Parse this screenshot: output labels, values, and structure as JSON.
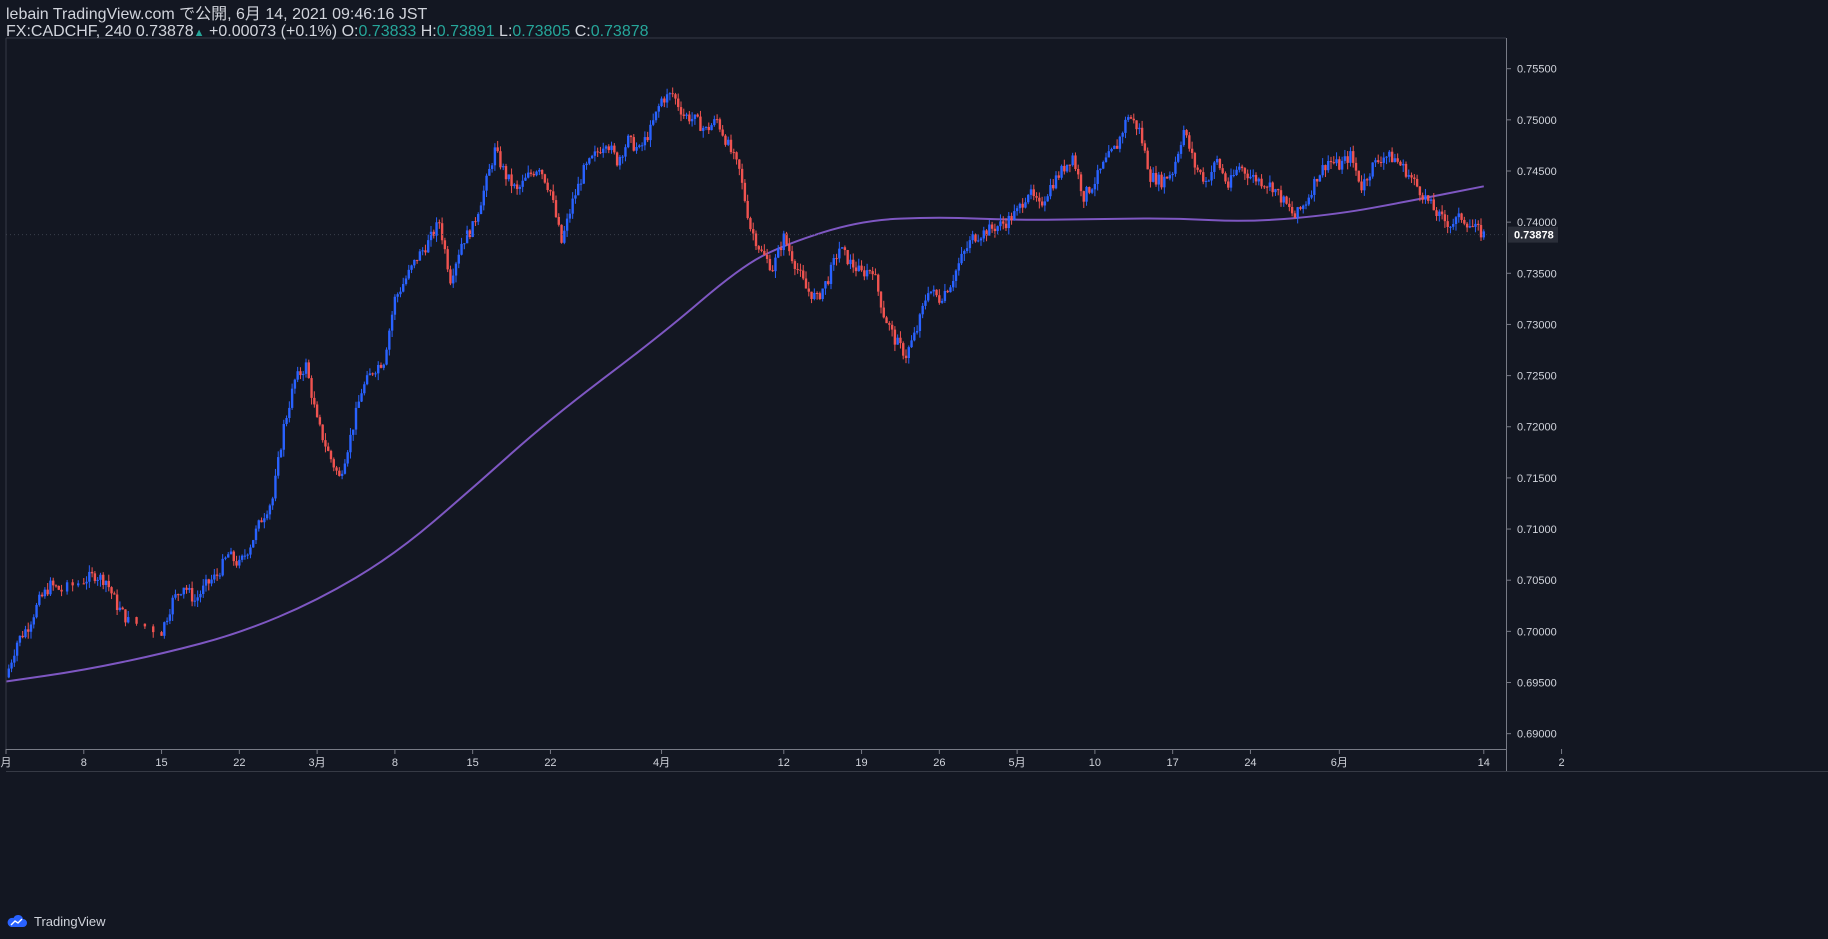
{
  "header": {
    "line1": "lebain TradingView.com で公開, 6月 14, 2021 09:46:16 JST",
    "symbol": "FX:CADCHF, 240",
    "last": "0.73878",
    "change": "+0.00073 (+0.1%)",
    "o_label": "O:",
    "o_value": "0.73833",
    "h_label": "H:",
    "h_value": "0.73891",
    "l_label": "L:",
    "l_value": "0.73805",
    "c_label": "C:",
    "c_value": "0.73878"
  },
  "branding": {
    "label": "TradingView",
    "icon": "tradingview-cloud-icon"
  },
  "colors": {
    "background": "#131722",
    "up": "#2962ff",
    "down": "#ef5350",
    "ma": "#7e57c2",
    "accent": "#26a69a",
    "text": "#d1d4dc",
    "axis": "#363a45"
  },
  "chart_data": {
    "type": "candlestick",
    "symbol": "FX:CADCHF",
    "interval": "240",
    "y_axis": {
      "position": "right",
      "range": [
        0.6885,
        0.758
      ],
      "ticks": [
        "0.69000",
        "0.69500",
        "0.70000",
        "0.70500",
        "0.71000",
        "0.71500",
        "0.72000",
        "0.72500",
        "0.73000",
        "0.73500",
        "0.74000",
        "0.74500",
        "0.75000",
        "0.75500"
      ]
    },
    "x_axis": {
      "range": [
        "2021-02-01",
        "2021-06-16"
      ],
      "ticks": [
        {
          "date": "2021-02-01",
          "label": "月"
        },
        {
          "date": "2021-02-08",
          "label": "8"
        },
        {
          "date": "2021-02-15",
          "label": "15"
        },
        {
          "date": "2021-02-22",
          "label": "22"
        },
        {
          "date": "2021-03-01",
          "label": "3月"
        },
        {
          "date": "2021-03-08",
          "label": "8"
        },
        {
          "date": "2021-03-15",
          "label": "15"
        },
        {
          "date": "2021-03-22",
          "label": "22"
        },
        {
          "date": "2021-04-01",
          "label": "4月"
        },
        {
          "date": "2021-04-12",
          "label": "12"
        },
        {
          "date": "2021-04-19",
          "label": "19"
        },
        {
          "date": "2021-04-26",
          "label": "26"
        },
        {
          "date": "2021-05-03",
          "label": "5月"
        },
        {
          "date": "2021-05-10",
          "label": "10"
        },
        {
          "date": "2021-05-17",
          "label": "17"
        },
        {
          "date": "2021-05-24",
          "label": "24"
        },
        {
          "date": "2021-06-01",
          "label": "6月"
        },
        {
          "date": "2021-06-14",
          "label": "14"
        },
        {
          "date": "2021-06-21",
          "label": "2"
        }
      ]
    },
    "price_line": {
      "value": 0.73878,
      "label": "0.73878"
    },
    "price_path": [
      {
        "date": "2021-02-01",
        "close": 0.6955
      },
      {
        "date": "2021-02-02",
        "close": 0.699
      },
      {
        "date": "2021-02-03",
        "close": 0.7005
      },
      {
        "date": "2021-02-04",
        "close": 0.703
      },
      {
        "date": "2021-02-05",
        "close": 0.7045
      },
      {
        "date": "2021-02-06",
        "close": 0.704
      },
      {
        "date": "2021-02-08",
        "close": 0.705
      },
      {
        "date": "2021-02-09",
        "close": 0.7055
      },
      {
        "date": "2021-02-10",
        "close": 0.705
      },
      {
        "date": "2021-02-11",
        "close": 0.7025
      },
      {
        "date": "2021-02-12",
        "close": 0.701
      },
      {
        "date": "2021-02-15",
        "close": 0.7
      },
      {
        "date": "2021-02-16",
        "close": 0.703
      },
      {
        "date": "2021-02-17",
        "close": 0.7045
      },
      {
        "date": "2021-02-18",
        "close": 0.703
      },
      {
        "date": "2021-02-19",
        "close": 0.7045
      },
      {
        "date": "2021-02-20",
        "close": 0.7055
      },
      {
        "date": "2021-02-21",
        "close": 0.7075
      },
      {
        "date": "2021-02-22",
        "close": 0.7065
      },
      {
        "date": "2021-02-23",
        "close": 0.7085
      },
      {
        "date": "2021-02-24",
        "close": 0.711
      },
      {
        "date": "2021-02-25",
        "close": 0.713
      },
      {
        "date": "2021-02-26",
        "close": 0.72
      },
      {
        "date": "2021-02-27",
        "close": 0.7245
      },
      {
        "date": "2021-02-28",
        "close": 0.726
      },
      {
        "date": "2021-03-01",
        "close": 0.7205
      },
      {
        "date": "2021-03-02",
        "close": 0.7175
      },
      {
        "date": "2021-03-03",
        "close": 0.715
      },
      {
        "date": "2021-03-04",
        "close": 0.719
      },
      {
        "date": "2021-03-05",
        "close": 0.7235
      },
      {
        "date": "2021-03-06",
        "close": 0.7255
      },
      {
        "date": "2021-03-07",
        "close": 0.7265
      },
      {
        "date": "2021-03-08",
        "close": 0.7325
      },
      {
        "date": "2021-03-09",
        "close": 0.7345
      },
      {
        "date": "2021-03-10",
        "close": 0.7365
      },
      {
        "date": "2021-03-11",
        "close": 0.738
      },
      {
        "date": "2021-03-12",
        "close": 0.74
      },
      {
        "date": "2021-03-13",
        "close": 0.7345
      },
      {
        "date": "2021-03-14",
        "close": 0.738
      },
      {
        "date": "2021-03-15",
        "close": 0.7395
      },
      {
        "date": "2021-03-16",
        "close": 0.743
      },
      {
        "date": "2021-03-17",
        "close": 0.747
      },
      {
        "date": "2021-03-18",
        "close": 0.7445
      },
      {
        "date": "2021-03-19",
        "close": 0.743
      },
      {
        "date": "2021-03-20",
        "close": 0.7445
      },
      {
        "date": "2021-03-21",
        "close": 0.7455
      },
      {
        "date": "2021-03-22",
        "close": 0.743
      },
      {
        "date": "2021-03-23",
        "close": 0.738
      },
      {
        "date": "2021-03-24",
        "close": 0.742
      },
      {
        "date": "2021-03-25",
        "close": 0.745
      },
      {
        "date": "2021-03-26",
        "close": 0.7465
      },
      {
        "date": "2021-03-27",
        "close": 0.748
      },
      {
        "date": "2021-03-28",
        "close": 0.746
      },
      {
        "date": "2021-03-29",
        "close": 0.748
      },
      {
        "date": "2021-03-30",
        "close": 0.747
      },
      {
        "date": "2021-03-31",
        "close": 0.749
      },
      {
        "date": "2021-04-01",
        "close": 0.752
      },
      {
        "date": "2021-04-02",
        "close": 0.7525
      },
      {
        "date": "2021-04-03",
        "close": 0.7505
      },
      {
        "date": "2021-04-04",
        "close": 0.75
      },
      {
        "date": "2021-04-05",
        "close": 0.749
      },
      {
        "date": "2021-04-06",
        "close": 0.75
      },
      {
        "date": "2021-04-07",
        "close": 0.7475
      },
      {
        "date": "2021-04-08",
        "close": 0.745
      },
      {
        "date": "2021-04-09",
        "close": 0.7395
      },
      {
        "date": "2021-04-10",
        "close": 0.737
      },
      {
        "date": "2021-04-11",
        "close": 0.7355
      },
      {
        "date": "2021-04-12",
        "close": 0.7385
      },
      {
        "date": "2021-04-13",
        "close": 0.736
      },
      {
        "date": "2021-04-14",
        "close": 0.7335
      },
      {
        "date": "2021-04-15",
        "close": 0.7325
      },
      {
        "date": "2021-04-16",
        "close": 0.7345
      },
      {
        "date": "2021-04-17",
        "close": 0.7375
      },
      {
        "date": "2021-04-18",
        "close": 0.736
      },
      {
        "date": "2021-04-19",
        "close": 0.735
      },
      {
        "date": "2021-04-20",
        "close": 0.7355
      },
      {
        "date": "2021-04-21",
        "close": 0.731
      },
      {
        "date": "2021-04-22",
        "close": 0.7285
      },
      {
        "date": "2021-04-23",
        "close": 0.727
      },
      {
        "date": "2021-04-24",
        "close": 0.7295
      },
      {
        "date": "2021-04-25",
        "close": 0.7335
      },
      {
        "date": "2021-04-26",
        "close": 0.7325
      },
      {
        "date": "2021-04-27",
        "close": 0.734
      },
      {
        "date": "2021-04-28",
        "close": 0.7365
      },
      {
        "date": "2021-04-29",
        "close": 0.7385
      },
      {
        "date": "2021-04-30",
        "close": 0.739
      },
      {
        "date": "2021-05-01",
        "close": 0.7395
      },
      {
        "date": "2021-05-02",
        "close": 0.74
      },
      {
        "date": "2021-05-03",
        "close": 0.741
      },
      {
        "date": "2021-05-04",
        "close": 0.743
      },
      {
        "date": "2021-05-05",
        "close": 0.7415
      },
      {
        "date": "2021-05-06",
        "close": 0.7435
      },
      {
        "date": "2021-05-07",
        "close": 0.745
      },
      {
        "date": "2021-05-08",
        "close": 0.7465
      },
      {
        "date": "2021-05-09",
        "close": 0.7425
      },
      {
        "date": "2021-05-10",
        "close": 0.744
      },
      {
        "date": "2021-05-11",
        "close": 0.746
      },
      {
        "date": "2021-05-12",
        "close": 0.7475
      },
      {
        "date": "2021-05-13",
        "close": 0.7505
      },
      {
        "date": "2021-05-14",
        "close": 0.749
      },
      {
        "date": "2021-05-15",
        "close": 0.7445
      },
      {
        "date": "2021-05-16",
        "close": 0.744
      },
      {
        "date": "2021-05-17",
        "close": 0.745
      },
      {
        "date": "2021-05-18",
        "close": 0.749
      },
      {
        "date": "2021-05-19",
        "close": 0.7455
      },
      {
        "date": "2021-05-20",
        "close": 0.744
      },
      {
        "date": "2021-05-21",
        "close": 0.746
      },
      {
        "date": "2021-05-22",
        "close": 0.7435
      },
      {
        "date": "2021-05-23",
        "close": 0.7455
      },
      {
        "date": "2021-05-24",
        "close": 0.7445
      },
      {
        "date": "2021-05-25",
        "close": 0.744
      },
      {
        "date": "2021-05-26",
        "close": 0.7435
      },
      {
        "date": "2021-05-27",
        "close": 0.742
      },
      {
        "date": "2021-05-28",
        "close": 0.7405
      },
      {
        "date": "2021-05-29",
        "close": 0.742
      },
      {
        "date": "2021-05-30",
        "close": 0.7445
      },
      {
        "date": "2021-05-31",
        "close": 0.746
      },
      {
        "date": "2021-06-01",
        "close": 0.7455
      },
      {
        "date": "2021-06-02",
        "close": 0.7465
      },
      {
        "date": "2021-06-03",
        "close": 0.7435
      },
      {
        "date": "2021-06-04",
        "close": 0.7455
      },
      {
        "date": "2021-06-05",
        "close": 0.7465
      },
      {
        "date": "2021-06-06",
        "close": 0.7462
      },
      {
        "date": "2021-06-07",
        "close": 0.745
      },
      {
        "date": "2021-06-08",
        "close": 0.7435
      },
      {
        "date": "2021-06-09",
        "close": 0.742
      },
      {
        "date": "2021-06-10",
        "close": 0.7405
      },
      {
        "date": "2021-06-11",
        "close": 0.7398
      },
      {
        "date": "2021-06-12",
        "close": 0.7405
      },
      {
        "date": "2021-06-13",
        "close": 0.7395
      },
      {
        "date": "2021-06-14",
        "close": 0.73878
      }
    ],
    "ma_series": [
      {
        "date": "2021-02-01",
        "value": 0.6951
      },
      {
        "date": "2021-02-08",
        "value": 0.6962
      },
      {
        "date": "2021-02-15",
        "value": 0.6978
      },
      {
        "date": "2021-02-22",
        "value": 0.6998
      },
      {
        "date": "2021-03-01",
        "value": 0.703
      },
      {
        "date": "2021-03-08",
        "value": 0.7075
      },
      {
        "date": "2021-03-15",
        "value": 0.714
      },
      {
        "date": "2021-03-22",
        "value": 0.7208
      },
      {
        "date": "2021-04-01",
        "value": 0.729
      },
      {
        "date": "2021-04-08",
        "value": 0.7355
      },
      {
        "date": "2021-04-12",
        "value": 0.7378
      },
      {
        "date": "2021-04-19",
        "value": 0.7402
      },
      {
        "date": "2021-04-26",
        "value": 0.7405
      },
      {
        "date": "2021-05-03",
        "value": 0.7402
      },
      {
        "date": "2021-05-10",
        "value": 0.7403
      },
      {
        "date": "2021-05-17",
        "value": 0.7404
      },
      {
        "date": "2021-05-24",
        "value": 0.74
      },
      {
        "date": "2021-06-01",
        "value": 0.7408
      },
      {
        "date": "2021-06-07",
        "value": 0.742
      },
      {
        "date": "2021-06-14",
        "value": 0.7435
      }
    ]
  }
}
